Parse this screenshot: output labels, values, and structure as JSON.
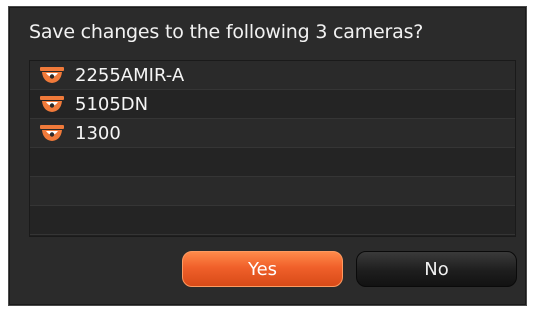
{
  "dialog": {
    "prompt": "Save changes to the following 3 cameras?",
    "cameras": [
      {
        "name": "2255AMIR-A",
        "icon": "dome-camera-icon"
      },
      {
        "name": "5105DN",
        "icon": "dome-camera-icon"
      },
      {
        "name": "1300",
        "icon": "dome-camera-icon"
      }
    ],
    "yes_label": "Yes",
    "no_label": "No"
  },
  "colors": {
    "dialog_bg": "#2b2b2b",
    "accent_orange": "#f0602a",
    "camera_icon": "#f07a3a"
  }
}
